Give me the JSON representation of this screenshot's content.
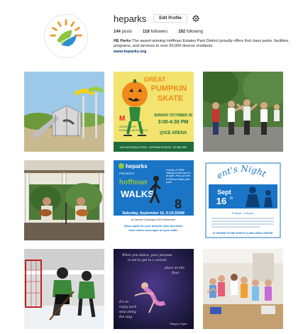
{
  "profile": {
    "username": "heparks",
    "edit_label": "Edit Profile",
    "posts_num": "144",
    "posts_label": "posts",
    "followers_num": "118",
    "followers_label": "followers",
    "following_num": "192",
    "following_label": "following",
    "bio_name": "HE Parks",
    "bio_text": "The award-winning Hoffman Estates Park District proudly offers first class parks, facilities, programs, and services to over 50,000 diverse residents.",
    "website": "www.heparks.org"
  },
  "posts": {
    "p2": {
      "title1": "GREAT",
      "title2": "PUMPKIN",
      "title3": "SKATE",
      "with_label": "SKATE WITH",
      "with_name": "RONALD MCDONALD",
      "date1": "SUNDAY OCTOBER 29",
      "date2": "3:00-4:30 PM",
      "venue": "@ICE ARENA",
      "footer": "1000 MACDONALD PKWY - HOFFMAN ESTATES - 847.885.7500"
    },
    "p5": {
      "brand": "heparks",
      "presents": "PRESENTS",
      "word1": "hoffman",
      "word2": "WALKS",
      "side_text": "A series of FREE walking events open to all ages. Pick up a free 8 Hoffman Walks prize pack!",
      "date_line": "Saturday, September 16, 9-10:30AM",
      "venue": "at Cannon Crossings (1675 Westmere)",
      "cta1": "Show spirit for your favorite team and wear",
      "cta2": "team colors and logos on your walk!"
    },
    "p6": {
      "title": "Parent's Night Out",
      "month": "Sept",
      "day": "16",
      "suffix": "th",
      "time": "5:30pm - 9:30pm",
      "footer": "AT PRAIRIE STONE SPORTS & WELLNESS CENTER"
    },
    "p8": {
      "quote_lines": [
        "When you dance, your purpose",
        "is not to get to a certain",
        "place on the",
        "floor.",
        "It's to",
        "enjoy each",
        "step along",
        "the way."
      ],
      "author": "- Wayne Dyer"
    }
  },
  "colors": {
    "accent_blue": "#1a75c7",
    "yellow_bg": "#f2e46e",
    "green_dark": "#1f6b3a",
    "link": "#003569"
  }
}
